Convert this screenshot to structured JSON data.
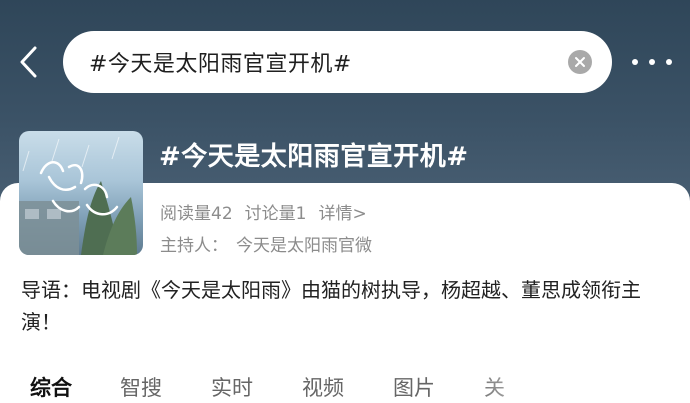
{
  "search": {
    "query": "#今天是太阳雨官宣开机#"
  },
  "topic": {
    "title": "#今天是太阳雨官宣开机#",
    "reads": "阅读量42",
    "discussions": "讨论量1",
    "details_link": "详情>",
    "host_label": "主持人：",
    "host_name": "今天是太阳雨官微",
    "intro": "导语：电视剧《今天是太阳雨》由猫的树执导，杨超越、董思成领衔主演！"
  },
  "tabs": [
    {
      "label": "综合"
    },
    {
      "label": "智搜"
    },
    {
      "label": "实时"
    },
    {
      "label": "视频"
    },
    {
      "label": "图片"
    },
    {
      "label": "关"
    }
  ],
  "icons": {
    "back": "chevron-left-icon",
    "clear": "clear-icon",
    "more": "more-icon"
  },
  "colors": {
    "header": "#34495d",
    "text_primary": "#222222",
    "text_secondary": "#8c8c8c"
  }
}
